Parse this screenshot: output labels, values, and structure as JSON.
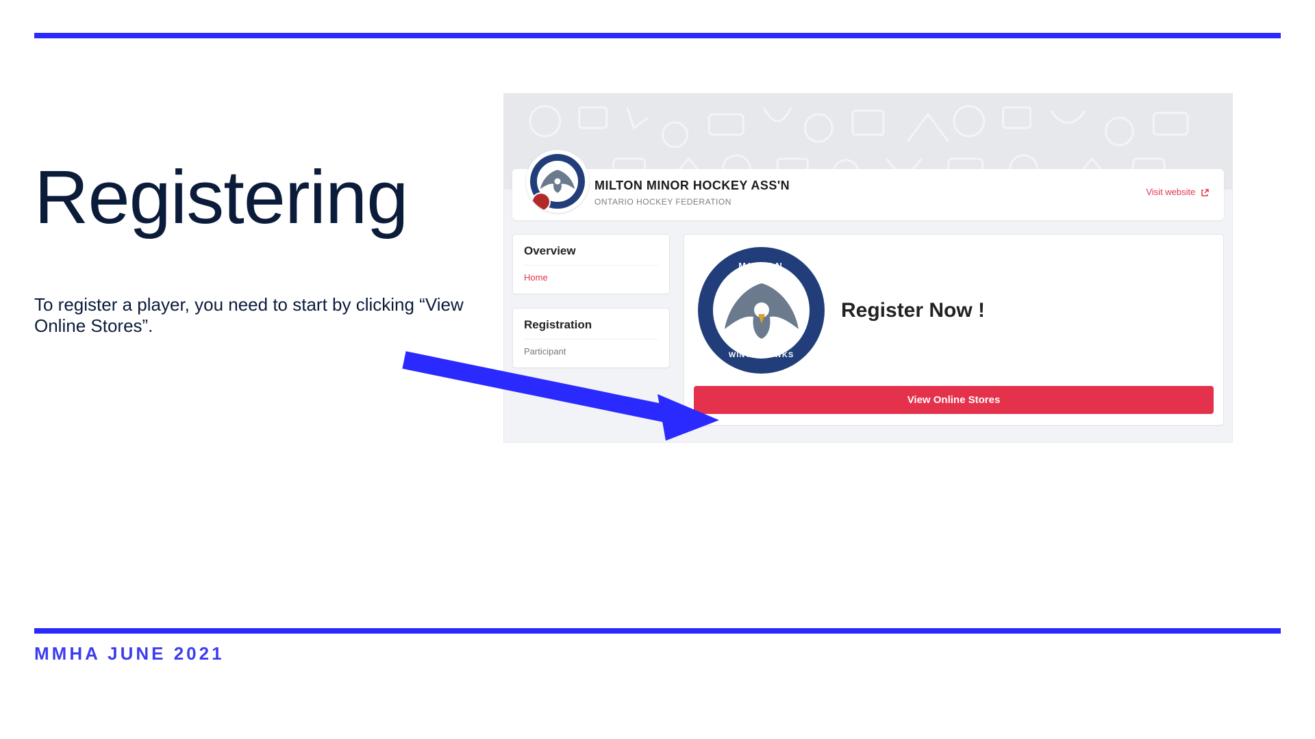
{
  "slide": {
    "title": "Registering",
    "body": "To register a player, you need to start by clicking “View Online Stores”.",
    "footer": "MMHA JUNE 2021"
  },
  "org": {
    "name": "MILTON MINOR HOCKEY ASS'N",
    "federation": "ONTARIO HOCKEY FEDERATION",
    "visit_label": "Visit website",
    "logo_top_text": "MILTON",
    "logo_bottom_text": "WINTERHAWKS"
  },
  "sidebar": {
    "overview": {
      "heading": "Overview",
      "items": [
        "Home"
      ]
    },
    "registration": {
      "heading": "Registration",
      "items": [
        "Participant"
      ]
    }
  },
  "main": {
    "register_heading": "Register Now !",
    "view_stores_label": "View Online Stores"
  },
  "colors": {
    "accent_blue": "#2a2aff",
    "brand_red": "#e5324c",
    "brand_navy": "#223e7a"
  }
}
